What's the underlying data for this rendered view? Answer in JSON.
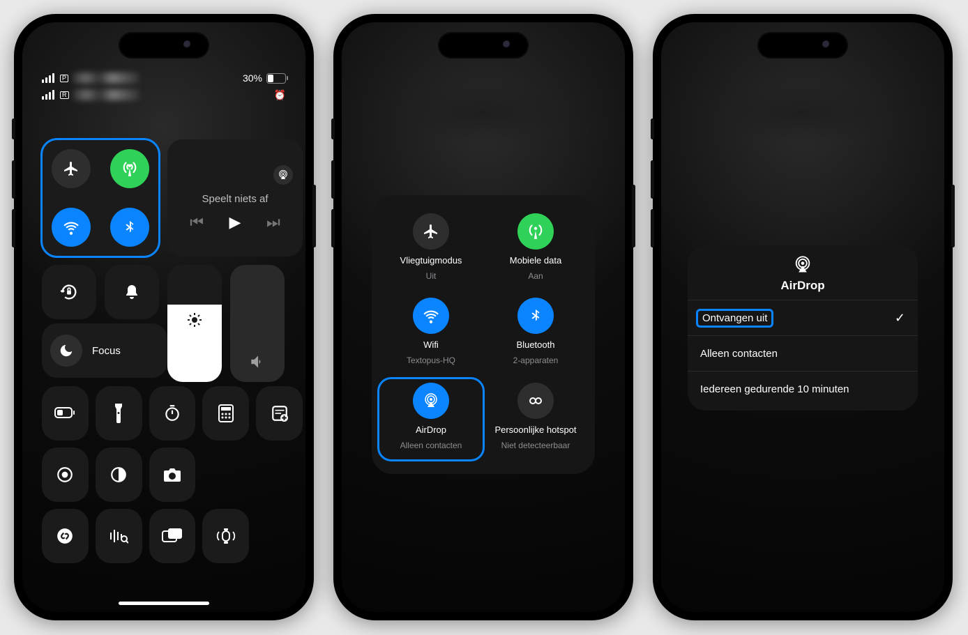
{
  "phone1": {
    "sim1_tag": "P",
    "sim2_tag": "R",
    "carrier1": "████████",
    "carrier2": "████████",
    "battery_pct": "30%",
    "battery_fill_pct": 30,
    "media": {
      "now_playing": "Speelt niets af"
    },
    "focus_label": "Focus"
  },
  "phone2": {
    "items": {
      "airplane": {
        "title": "Vliegtuigmodus",
        "sub": "Uit"
      },
      "cellular": {
        "title": "Mobiele data",
        "sub": "Aan"
      },
      "wifi": {
        "title": "Wifi",
        "sub": "Textopus-HQ"
      },
      "bluetooth": {
        "title": "Bluetooth",
        "sub": "2-apparaten"
      },
      "airdrop": {
        "title": "AirDrop",
        "sub": "Alleen contacten"
      },
      "hotspot": {
        "title": "Persoonlijke hotspot",
        "sub": "Niet detecteerbaar"
      }
    }
  },
  "phone3": {
    "title": "AirDrop",
    "options": {
      "off": "Ontvangen uit",
      "contacts": "Alleen contacten",
      "everyone": "Iedereen gedurende 10 minuten"
    },
    "selected_check": "✓"
  }
}
